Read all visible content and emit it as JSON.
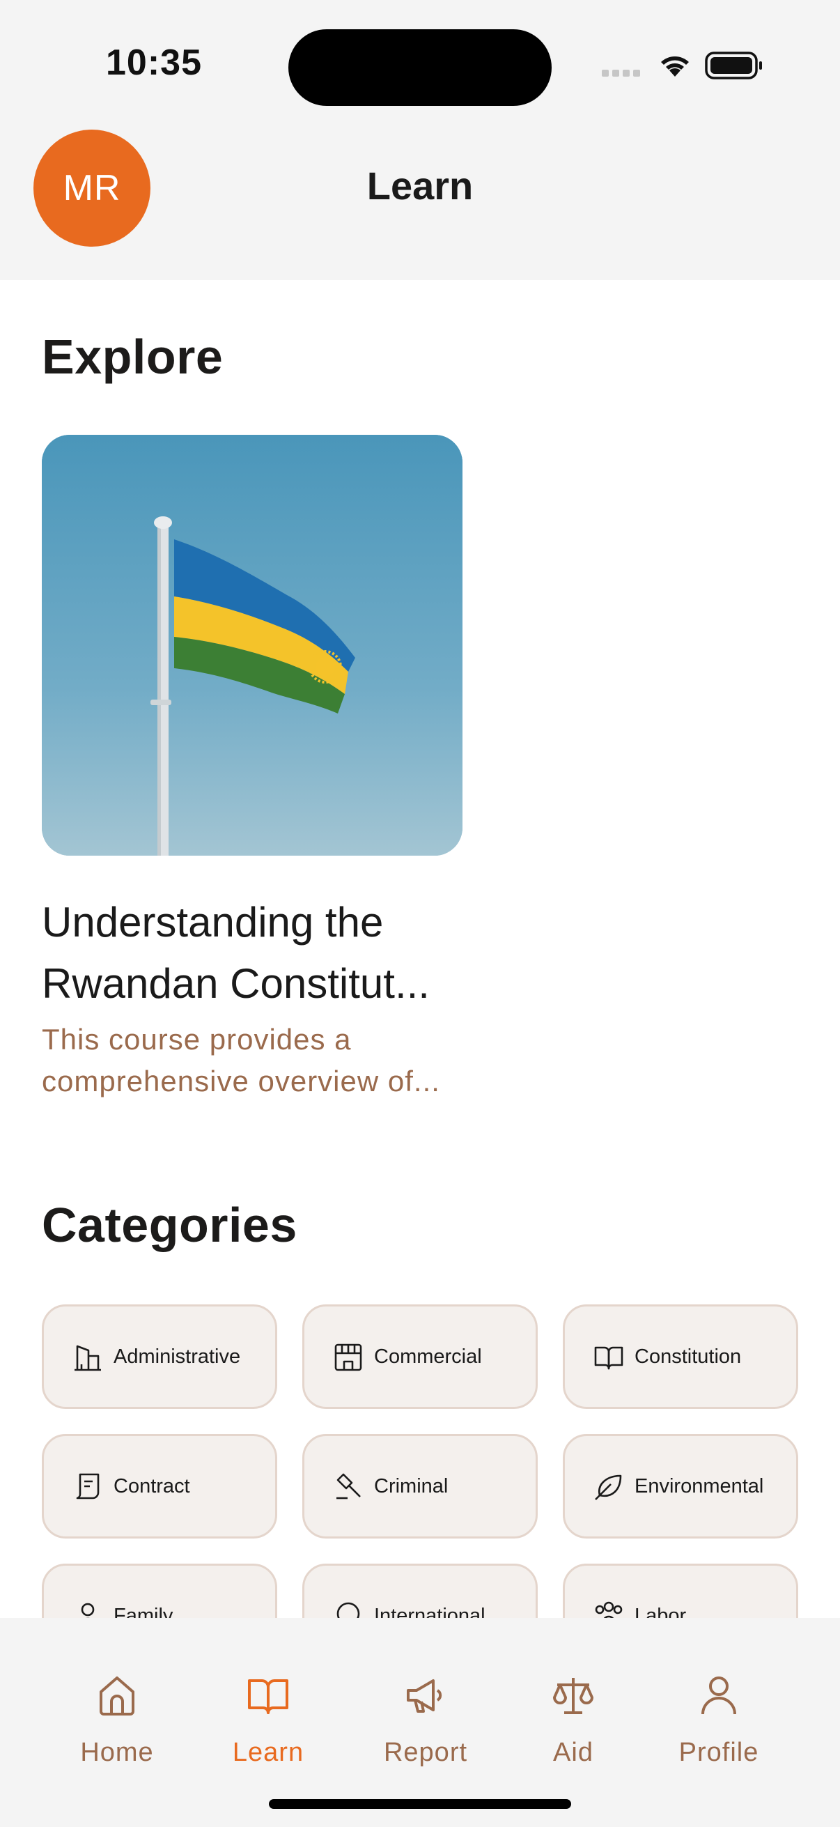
{
  "status_bar": {
    "time": "10:35"
  },
  "header": {
    "avatar_initials": "MR",
    "title": "Learn"
  },
  "explore": {
    "heading": "Explore",
    "course": {
      "title": "Understanding the Rwandan Constitut...",
      "description": "This course provides a comprehensive overview of..."
    }
  },
  "categories": {
    "heading": "Categories",
    "items": [
      {
        "label": "Administrative",
        "icon": "building-icon"
      },
      {
        "label": "Commercial",
        "icon": "storefront-icon"
      },
      {
        "label": "Constitution",
        "icon": "book-open-icon"
      },
      {
        "label": "Contract",
        "icon": "scroll-icon"
      },
      {
        "label": "Criminal",
        "icon": "gavel-icon"
      },
      {
        "label": "Environmental",
        "icon": "leaf-icon"
      },
      {
        "label": "Family",
        "icon": "person-icon"
      },
      {
        "label": "International",
        "icon": "globe-icon"
      },
      {
        "label": "Labor",
        "icon": "group-icon"
      }
    ]
  },
  "bottom_nav": {
    "items": [
      {
        "label": "Home",
        "icon": "home-icon"
      },
      {
        "label": "Learn",
        "icon": "book-open-icon",
        "active": true
      },
      {
        "label": "Report",
        "icon": "megaphone-icon"
      },
      {
        "label": "Aid",
        "icon": "scales-icon"
      },
      {
        "label": "Profile",
        "icon": "user-icon"
      }
    ]
  },
  "colors": {
    "accent": "#e86a1f",
    "muted_brown": "#9a6a4c",
    "chip_bg": "#f4f0ed",
    "chip_border": "#e4d5cc",
    "flag_blue": "#1f6fb0",
    "flag_yellow": "#f4c32a",
    "flag_green": "#3c7f34"
  }
}
